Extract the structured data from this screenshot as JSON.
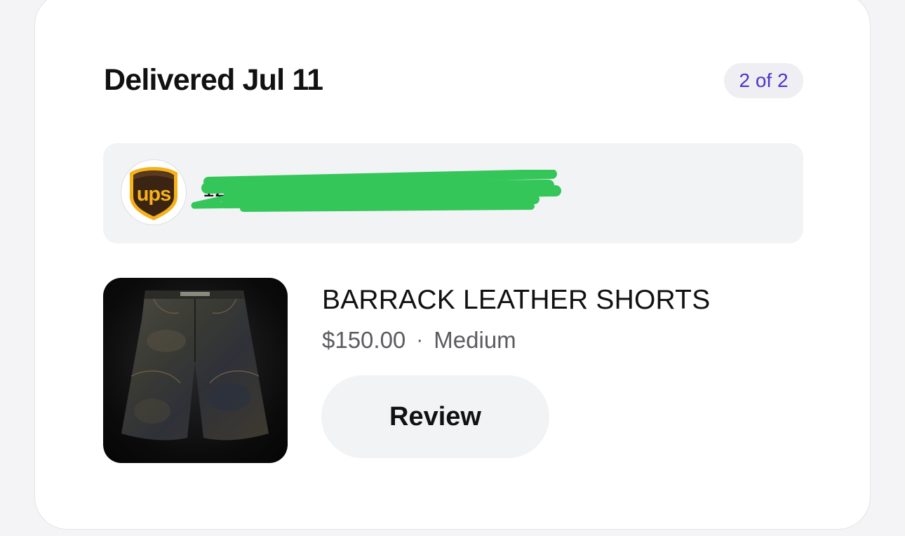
{
  "order": {
    "status_title": "Delivered Jul 11",
    "shipment_counter": "2 of 2"
  },
  "tracking": {
    "carrier_logo_text": "ups",
    "carrier_logo_icon": "ups-shield-icon",
    "tracking_number_partial": "1Z",
    "redaction_color": "#34c659"
  },
  "product": {
    "name": "BARRACK LEATHER SHORTS",
    "price": "$150.00",
    "separator": "·",
    "size": "Medium",
    "image_icon": "leather-shorts-image"
  },
  "actions": {
    "review_label": "Review"
  },
  "colors": {
    "badge_text": "#4a37c8",
    "ups_brown": "#3b2412",
    "ups_gold": "#f6b21a"
  }
}
